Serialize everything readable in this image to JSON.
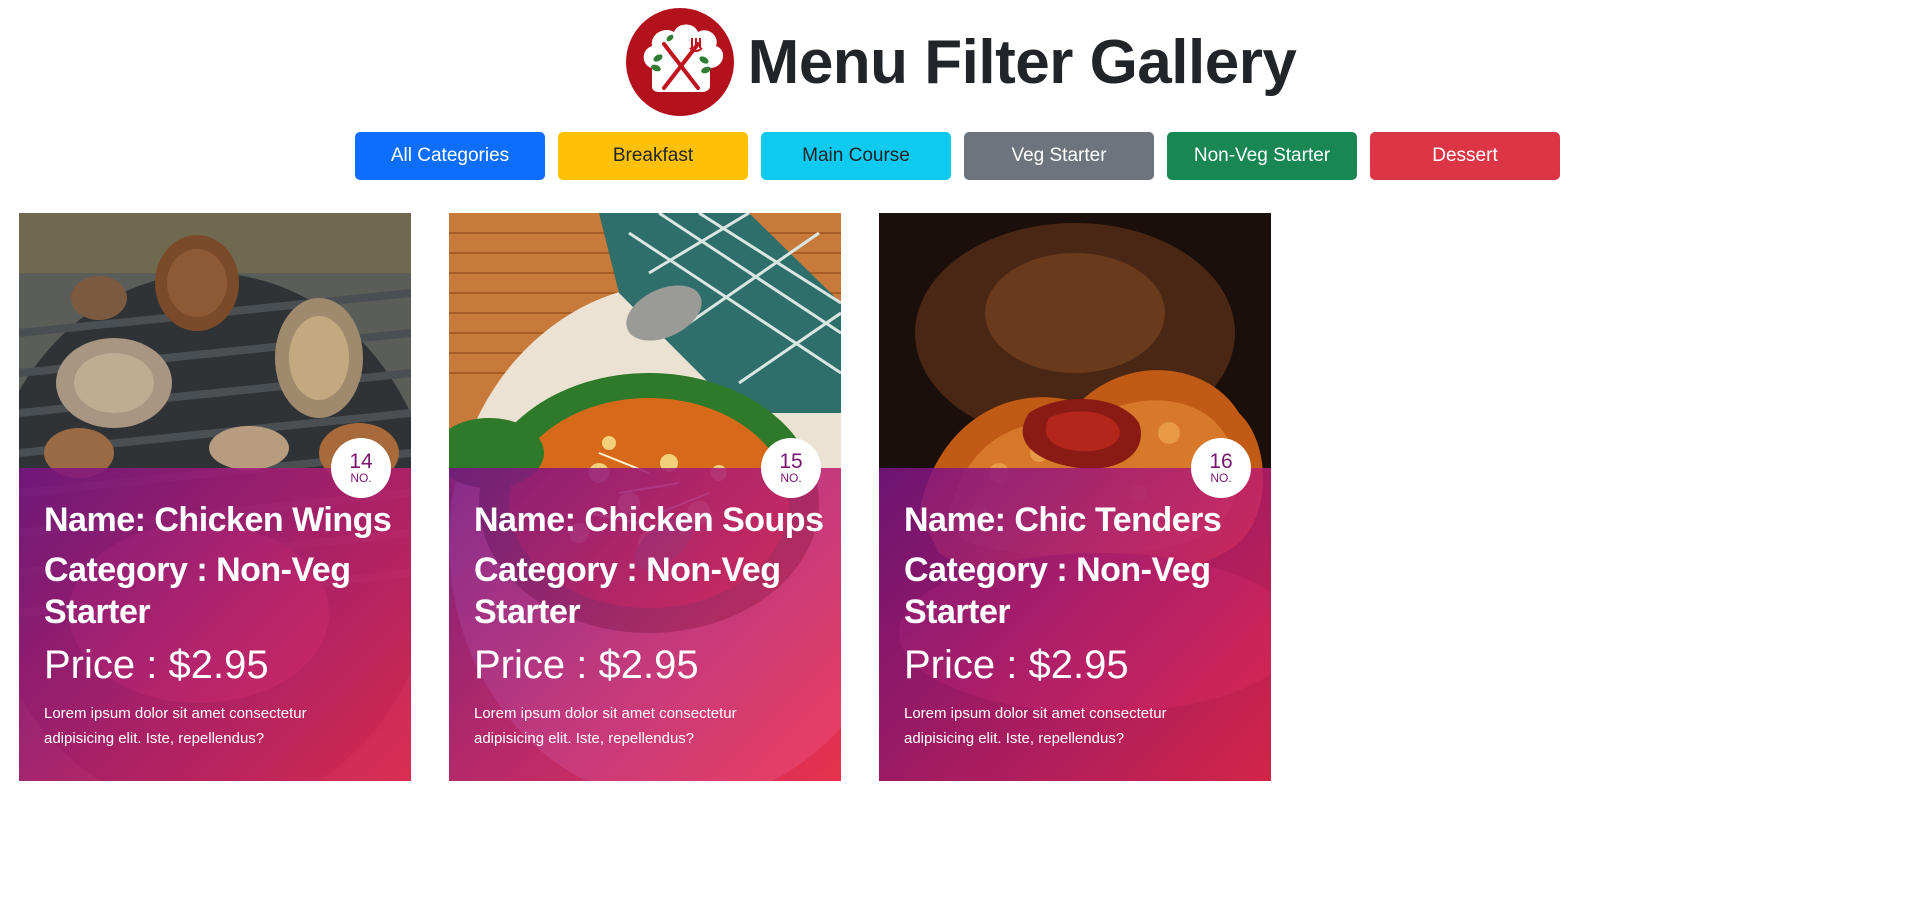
{
  "header": {
    "title": "Menu Filter Gallery",
    "logo_icon": "chef-hat-fork-knife-icon"
  },
  "filters": [
    {
      "label": "All Categories",
      "bg": "#0d6efd",
      "fg": "#ffffff"
    },
    {
      "label": "Breakfast",
      "bg": "#ffc107",
      "fg": "#212529"
    },
    {
      "label": "Main Course",
      "bg": "#0dcaf0",
      "fg": "#212529"
    },
    {
      "label": "Veg Starter",
      "bg": "#6c757d",
      "fg": "#ffffff"
    },
    {
      "label": "Non-Veg Starter",
      "bg": "#198754",
      "fg": "#ffffff"
    },
    {
      "label": "Dessert",
      "bg": "#dc3545",
      "fg": "#ffffff"
    }
  ],
  "cards": [
    {
      "number": "14",
      "no_label": "NO.",
      "name": "Name: Chicken Wings",
      "category": "Category : Non-Veg Starter",
      "price": "Price : $2.95",
      "description": "Lorem ipsum dolor sit amet consectetur adipisicing elit. Iste, repellendus?",
      "image": "grilled-chicken-photo"
    },
    {
      "number": "15",
      "no_label": "NO.",
      "name": "Name: Chicken Soups",
      "category": "Category : Non-Veg Starter",
      "price": "Price : $2.95",
      "description": "Lorem ipsum dolor sit amet consectetur adipisicing elit. Iste, repellendus?",
      "image": "chicken-soup-photo"
    },
    {
      "number": "16",
      "no_label": "NO.",
      "name": "Name: Chic Tenders",
      "category": "Category : Non-Veg Starter",
      "price": "Price : $2.95",
      "description": "Lorem ipsum dolor sit amet consectetur adipisicing elit. Iste, repellendus?",
      "image": "fried-chicken-photo"
    }
  ]
}
